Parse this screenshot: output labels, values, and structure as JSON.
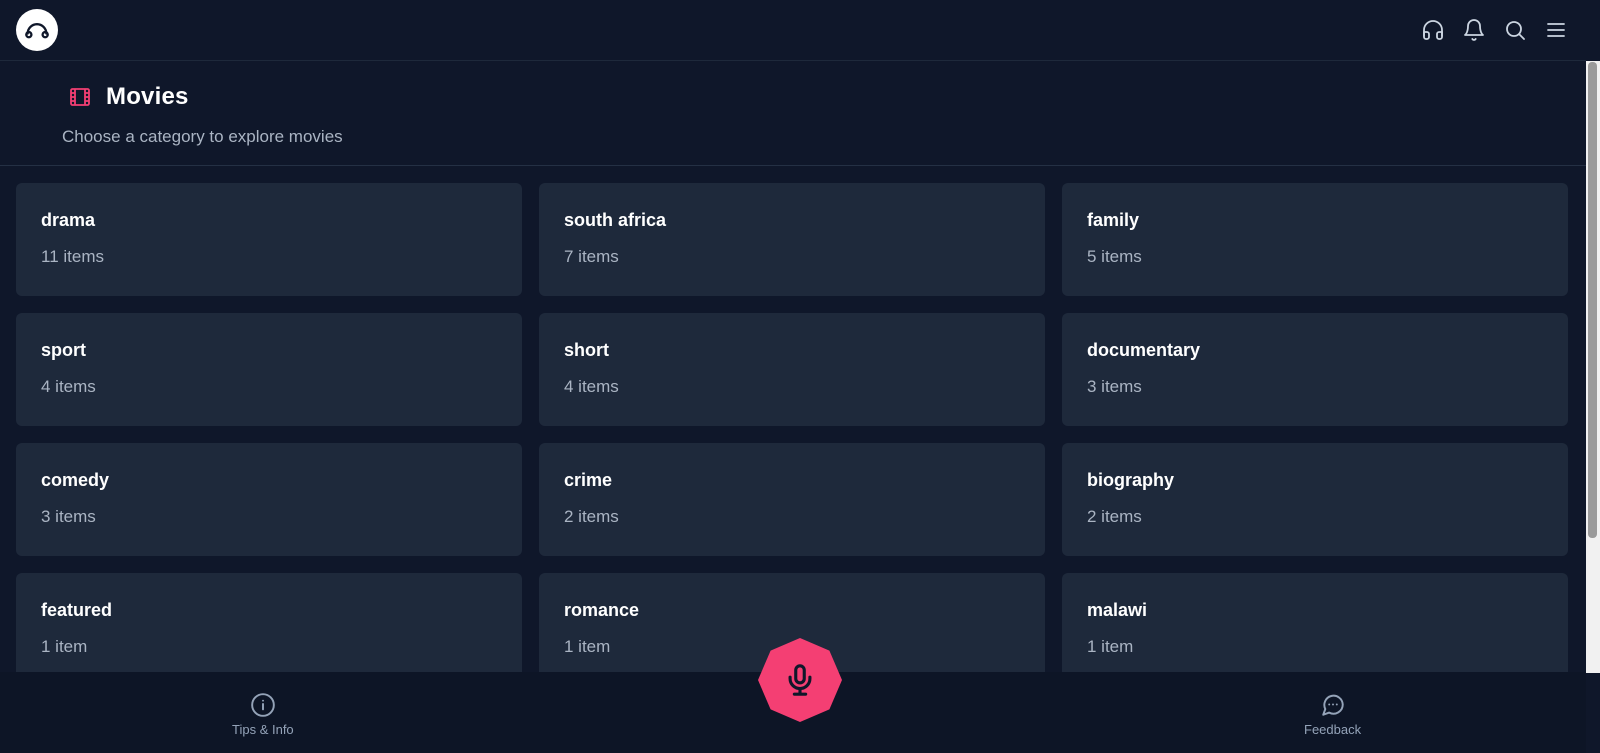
{
  "header": {
    "title": "Movies",
    "subtitle": "Choose a category to explore movies",
    "title_icon": "film-icon",
    "accent_color": "#f43f73"
  },
  "topbar": {
    "logo_icon": "headphones-logo-icon",
    "icons": [
      "headphones-icon",
      "bell-icon",
      "search-icon",
      "menu-icon"
    ]
  },
  "categories": [
    {
      "name": "drama",
      "count": "11 items"
    },
    {
      "name": "south africa",
      "count": "7 items"
    },
    {
      "name": "family",
      "count": "5 items"
    },
    {
      "name": "sport",
      "count": "4 items"
    },
    {
      "name": "short",
      "count": "4 items"
    },
    {
      "name": "documentary",
      "count": "3 items"
    },
    {
      "name": "comedy",
      "count": "3 items"
    },
    {
      "name": "crime",
      "count": "2 items"
    },
    {
      "name": "biography",
      "count": "2 items"
    },
    {
      "name": "featured",
      "count": "1 item"
    },
    {
      "name": "romance",
      "count": "1 item"
    },
    {
      "name": "malawi",
      "count": "1 item"
    }
  ],
  "bottom_nav": {
    "tips_label": "Tips & Info",
    "feedback_label": "Feedback",
    "mic_icon": "microphone-icon"
  }
}
